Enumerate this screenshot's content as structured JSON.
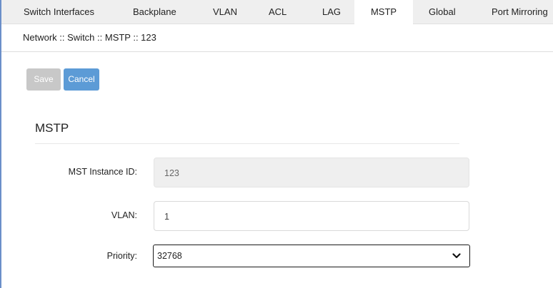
{
  "tabs": [
    {
      "label": "Switch Interfaces",
      "active": false
    },
    {
      "label": "Backplane",
      "active": false
    },
    {
      "label": "VLAN",
      "active": false
    },
    {
      "label": "ACL",
      "active": false
    },
    {
      "label": "LAG",
      "active": false
    },
    {
      "label": "MSTP",
      "active": true
    },
    {
      "label": "Global",
      "active": false
    },
    {
      "label": "Port Mirroring",
      "active": false
    }
  ],
  "breadcrumb": "Network :: Switch :: MSTP :: 123",
  "toolbar": {
    "save_label": "Save",
    "cancel_label": "Cancel"
  },
  "section": {
    "title": "MSTP"
  },
  "fields": {
    "instance_id": {
      "label": "MST Instance ID:",
      "value": "123"
    },
    "vlan": {
      "label": "VLAN:",
      "value": "1"
    },
    "priority": {
      "label": "Priority:",
      "value": "32768"
    }
  },
  "colors": {
    "accent": "#5c9bd6",
    "disabled": "#c8c8c8",
    "frame": "#6b8fc9"
  },
  "icons": {
    "select_arrow": "chevron-down-icon"
  }
}
